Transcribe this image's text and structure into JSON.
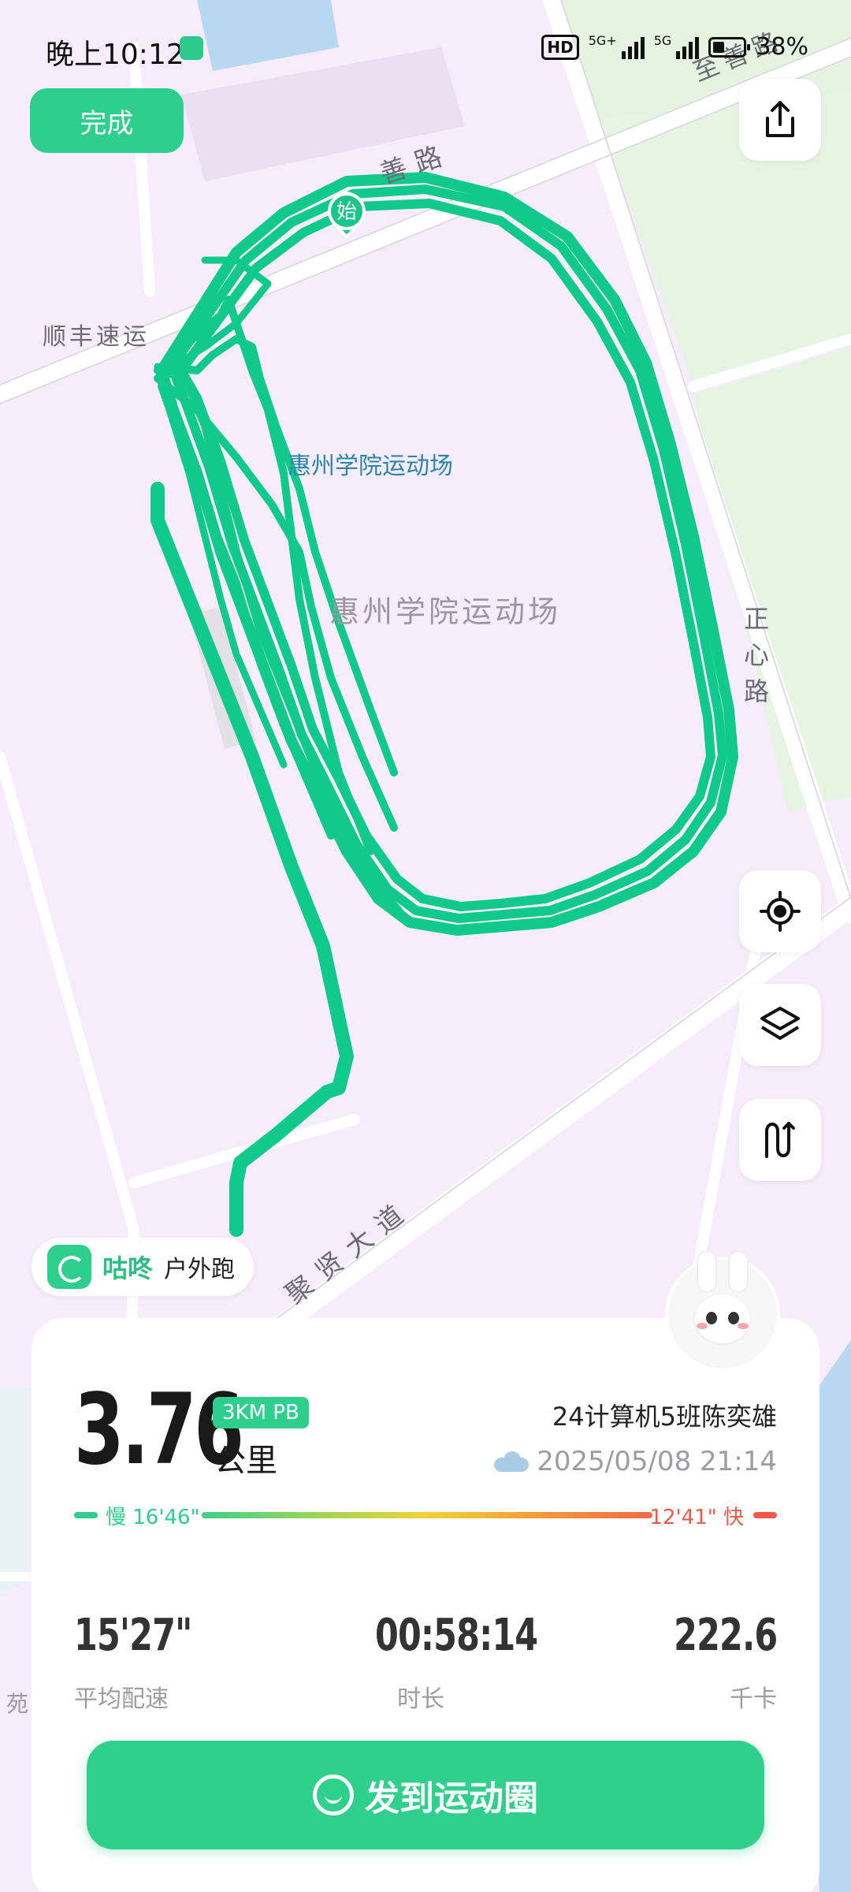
{
  "status_bar": {
    "time": "晚上10:12",
    "hd_label": "HD",
    "network_1": "5G+",
    "network_2": "5G",
    "battery": "38%"
  },
  "map": {
    "labels": {
      "road_top": "善路",
      "road_top_right": "至善路",
      "place_left": "顺丰速运",
      "venue_small": "惠州学院运动场",
      "venue_large": "惠州学院运动场",
      "road_right": "正心路",
      "road_bottom": "聚贤大道",
      "edge_left": "苑"
    },
    "start_marker": "始",
    "colors": {
      "track": "#12c98c",
      "background": "#f6ecfb",
      "green_area": "#e6f5e2",
      "water": "#b9d9f2"
    }
  },
  "controls": {
    "done_label": "完成",
    "share_icon": "share-icon",
    "locate_icon": "locate-icon",
    "layers_icon": "layers-icon",
    "route_icon": "route-icon"
  },
  "app_tag": {
    "brand": "咕咚",
    "mode": "户外跑"
  },
  "summary": {
    "distance": "3.76",
    "pb_badge": "3KM PB",
    "unit": "公里",
    "user_name": "24计算机5班陈奕雄",
    "datetime": "2025/05/08 21:14",
    "pace_slow_label": "慢 16'46\"",
    "pace_fast_label": "12'41\" 快",
    "colors": {
      "slow": "#2ecf8c",
      "fast": "#ef5a48"
    }
  },
  "stats": [
    {
      "value": "15'27\"",
      "label": "平均配速"
    },
    {
      "value": "00:58:14",
      "label": "时长"
    },
    {
      "value": "222.6",
      "label": "千卡"
    }
  ],
  "share_button_label": "发到运动圈"
}
